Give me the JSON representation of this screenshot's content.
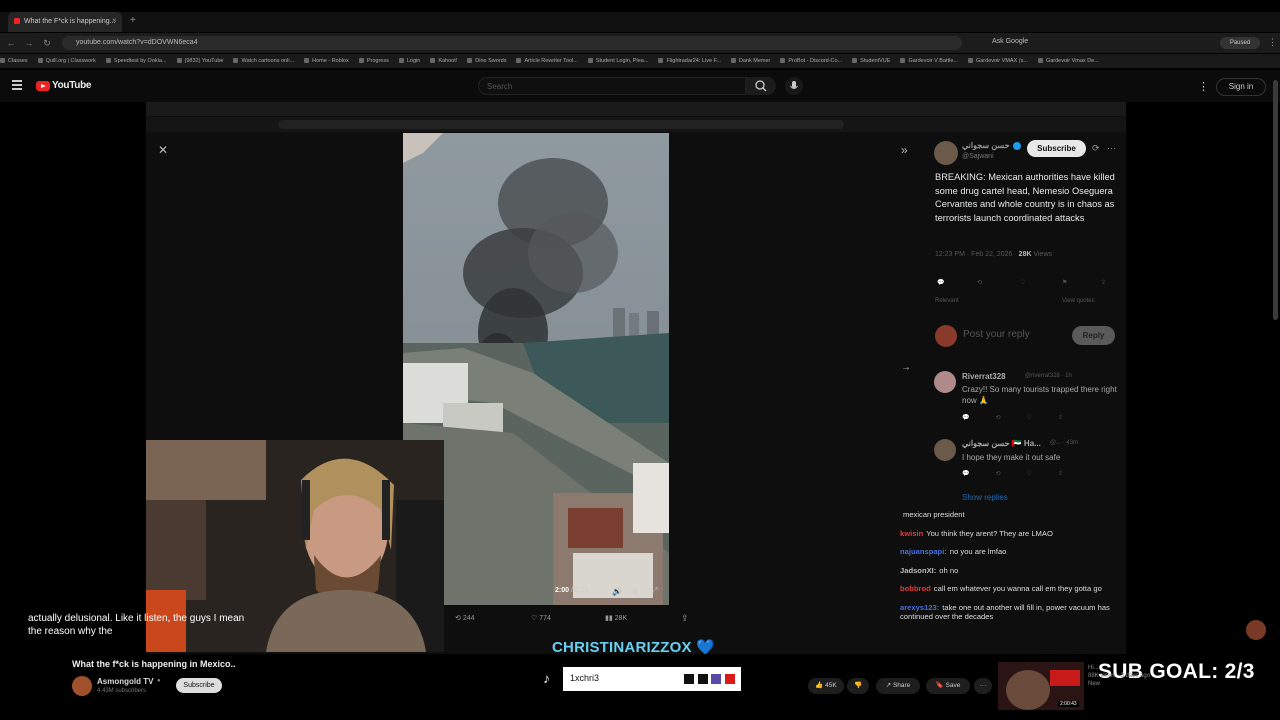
{
  "browser": {
    "tab_title": "What the F*ck is happening...",
    "url": "youtube.com/watch?v=dDOVWN6eca4",
    "ask_google": "Ask Google",
    "paused": "Paused",
    "bookmarks": [
      "Classes",
      "Quill.org | Classwork",
      "Speedtest by Ookla...",
      "(9832) YouTube",
      "Watch cartoons onli...",
      "Home - Roblox",
      "Progress",
      "Login",
      "Kahoot!",
      "Dino Swords",
      "Article Rewriter Tool...",
      "Student Login, Plea...",
      "Flightradar24: Live F...",
      "Dank Memer",
      "ProBot - Discord-Co...",
      "StudentVUE",
      "Gardevoir V Battle...",
      "Gardevoir VMAX (s...",
      "Gardevoir Vmax De..."
    ]
  },
  "youtube": {
    "logo_text": "YouTube",
    "search_placeholder": "Search",
    "signin": "Sign in"
  },
  "tweet": {
    "author": "حسن سجواني",
    "handle": "@Sajwani",
    "subscribe": "Subscribe",
    "text": "BREAKING: Mexican authorities have killed some drug cartel head, Nemesio Oseguera Cervantes and whole country is in chaos as terrorists launch coordinated attacks",
    "time": "12:23 PM · Feb 22, 2026 · ",
    "views": "28K",
    "views_label": " Views",
    "relevant": "Relevant",
    "view_quotes": "View quotes",
    "reply_placeholder": "Post your reply",
    "reply_button": "Reply",
    "replies": [
      {
        "name": "Riverrat328",
        "handle": "@riverrat328 · 1h",
        "text": "Crazy!! So many tourists trapped there right now 🙏"
      },
      {
        "name": "حسن سجواني 🇦🇪 Ha...",
        "handle": "@... · 43m",
        "text": "I hope they make it out safe"
      }
    ],
    "show_replies": "Show replies",
    "bottom_actions": {
      "retweets": "244",
      "likes": "774",
      "views": "28K"
    }
  },
  "video": {
    "time_current": "2:00",
    "time_total": " / 0:24"
  },
  "chat": [
    {
      "user": "",
      "text": "mexican president",
      "color": "#ddd"
    },
    {
      "user": "kwisin",
      "text": "You think they arent? They are LMAO",
      "color": "#e23c3c"
    },
    {
      "user": "najuanspapi:",
      "text": "no you are lmfao",
      "color": "#4a6fd8"
    },
    {
      "user": "JadsonXI:",
      "text": "oh no",
      "color": "#bbb"
    },
    {
      "user": "bobbrod",
      "text": "call em whatever you wanna call em they gotta go",
      "color": "#e23c3c"
    },
    {
      "user": "arexys123:",
      "text": "take one out another will fill in, power vacuum has continued over the decades",
      "color": "#4a6fd8"
    }
  ],
  "caption": "actually delusional. Like it listen, the guys I mean the reason why the",
  "overlay": {
    "handle": "CHRISTINARIZZOX 💙",
    "tiktok_user": "1xchri3",
    "sub_goal": "SUB GOAL: 2/3"
  },
  "video_info": {
    "title": "What the f*ck is happening in Mexico..",
    "channel": "Asmongold TV",
    "subs": "4.43M subscribers",
    "subscribe": "Subscribe",
    "likes": "45K",
    "share": "Share",
    "save": "Save",
    "rec_meta": [
      "Hi...",
      "88K views · 3 days ago",
      "New"
    ],
    "rec_duration": "2:00:43"
  }
}
